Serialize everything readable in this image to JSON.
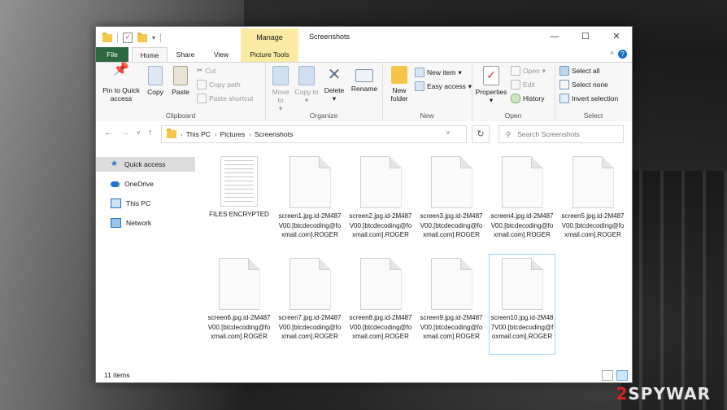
{
  "window": {
    "title": "Screenshots",
    "manage_tab": "Manage"
  },
  "ribbon_tabs": {
    "file": "File",
    "home": "Home",
    "share": "Share",
    "view": "View",
    "picture_tools": "Picture Tools"
  },
  "clipboard": {
    "pin": "Pin to Quick access",
    "copy": "Copy",
    "paste": "Paste",
    "cut": "Cut",
    "copy_path": "Copy path",
    "paste_shortcut": "Paste shortcut",
    "label": "Clipboard"
  },
  "organize": {
    "move_to": "Move to",
    "copy_to": "Copy to",
    "delete": "Delete",
    "rename": "Rename",
    "label": "Organize"
  },
  "new": {
    "new_folder": "New folder",
    "new_item": "New item",
    "easy_access": "Easy access",
    "label": "New"
  },
  "open": {
    "properties": "Properties",
    "open": "Open",
    "edit": "Edit",
    "history": "History",
    "label": "Open"
  },
  "select": {
    "select_all": "Select all",
    "select_none": "Select none",
    "invert": "Invert selection",
    "label": "Select"
  },
  "address": {
    "crumbs": [
      "This PC",
      "Pictures",
      "Screenshots"
    ],
    "search_placeholder": "Search Screenshots"
  },
  "nav": {
    "items": [
      "Quick access",
      "OneDrive",
      "This PC",
      "Network"
    ]
  },
  "files": [
    "FILES ENCRYPTED",
    "screen1.jpg.id-2M487V00.[btcdecoding@foxmail.com].ROGER",
    "screen2.jpg.id-2M487V00.[btcdecoding@foxmail.com].ROGER",
    "screen3.jpg.id-2M487V00.[btcdecoding@foxmail.com].ROGER",
    "screen4.jpg.id-2M487V00.[btcdecoding@foxmail.com].ROGER",
    "screen5.jpg.id-2M487V00.[btcdecoding@foxmail.com].ROGER",
    "screen6.jpg.id-2M487V00.[btcdecoding@foxmail.com].ROGER",
    "screen7.jpg.id-2M487V00.[btcdecoding@foxmail.com].ROGER",
    "screen8.jpg.id-2M487V00.[btcdecoding@foxmail.com].ROGER",
    "screen9.jpg.id-2M487V00.[btcdecoding@foxmail.com].ROGER",
    "screen10.jpg.id-2M487V00.[btcdecoding@foxmail.com].ROGER"
  ],
  "status": {
    "count": "11 items"
  },
  "watermark": {
    "prefix": "2",
    "text": "SPYWAR"
  },
  "colors": {
    "file_tab": "#2b6a3e",
    "manage_tab": "#fbeaa1",
    "selection_border": "#99d1ff"
  }
}
